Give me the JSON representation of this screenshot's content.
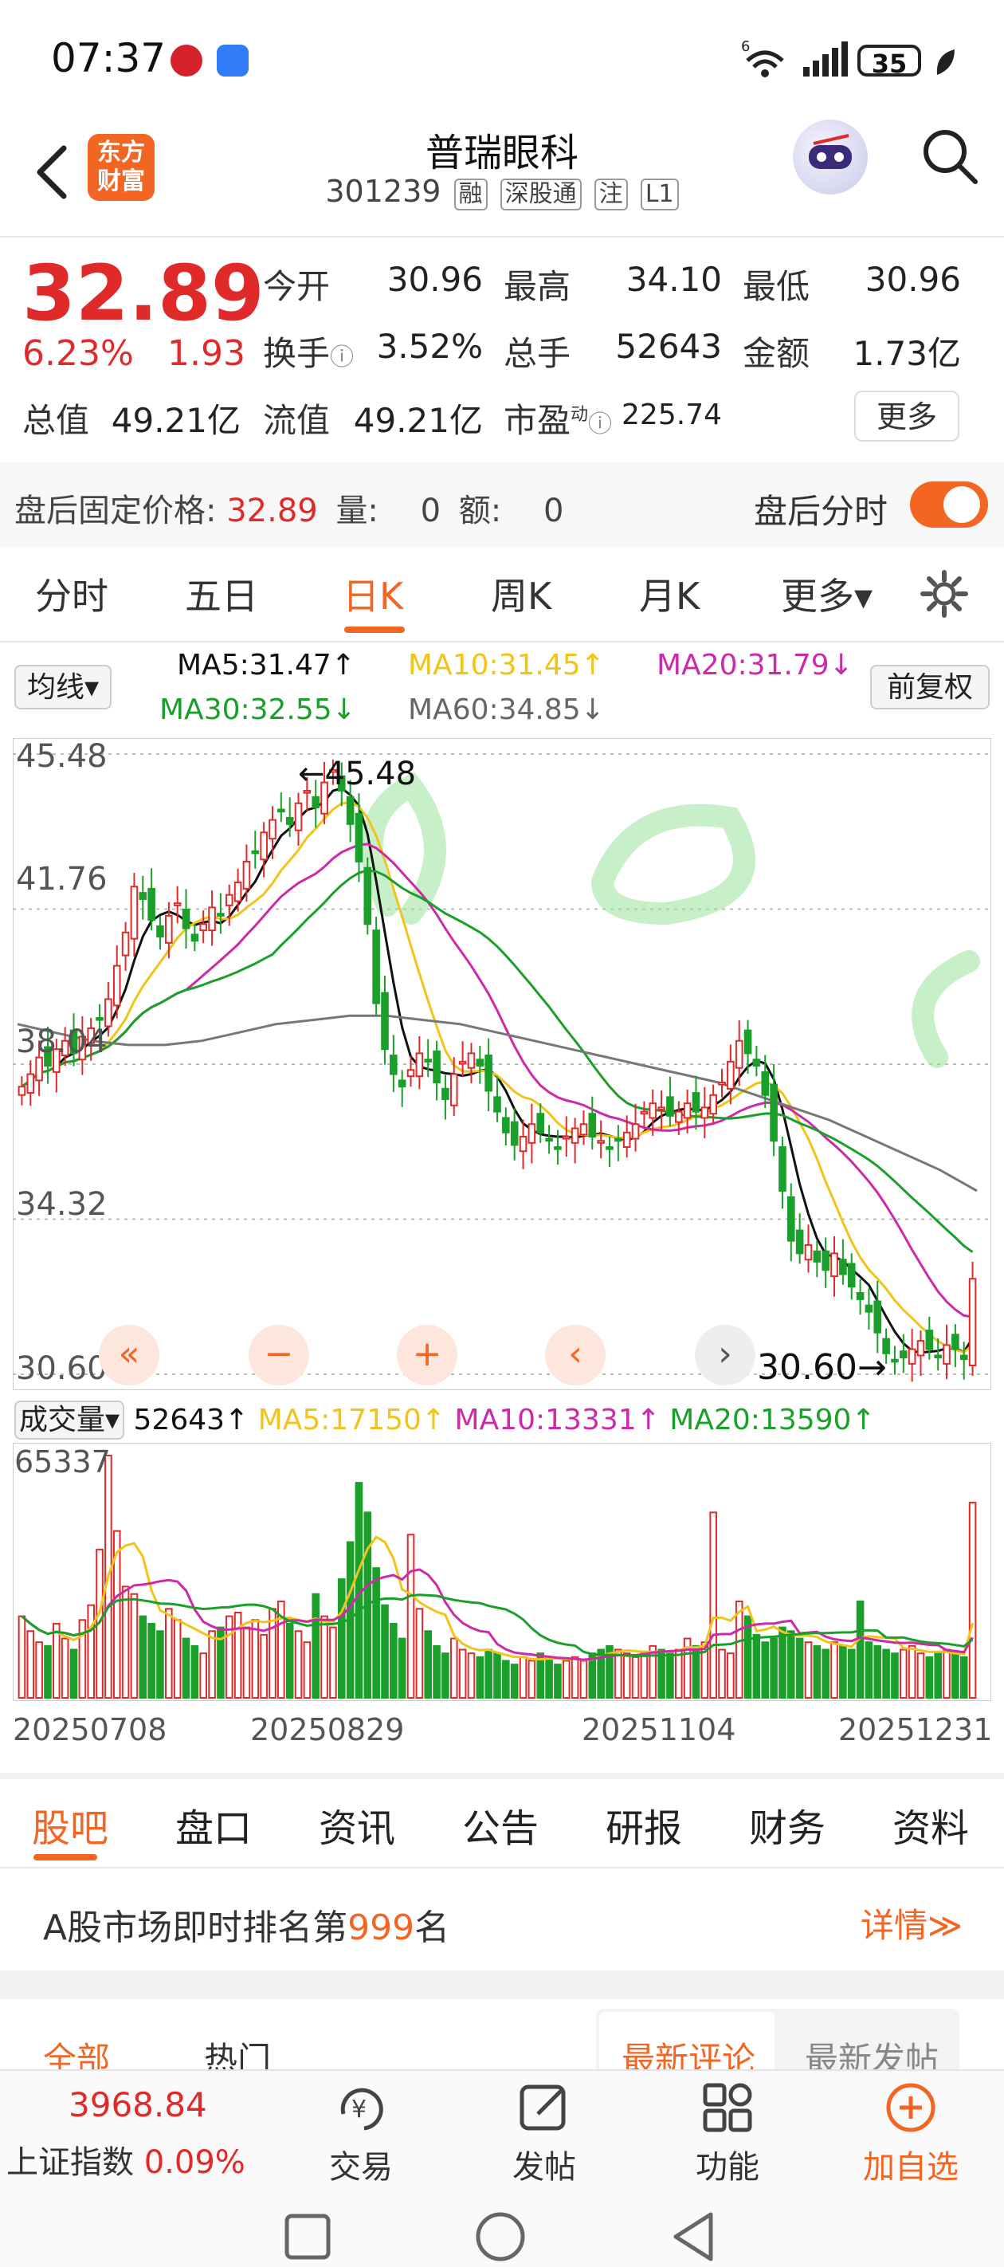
{
  "status_bar": {
    "time": "07:37",
    "battery": "35",
    "network": "6"
  },
  "header": {
    "logo_text_1": "东方",
    "logo_text_2": "财富",
    "stock_name": "普瑞眼科",
    "stock_code": "301239",
    "tags": [
      "融",
      "深股通",
      "注",
      "L1"
    ]
  },
  "quote": {
    "price": "32.89",
    "change_pct": "6.23%",
    "change_abs": "1.93",
    "open_label": "今开",
    "open_value": "30.96",
    "high_label": "最高",
    "high_value": "34.10",
    "low_label": "最低",
    "low_value": "30.96",
    "turnover_label": "换手",
    "turnover_value": "3.52%",
    "volume_label": "总手",
    "volume_value": "52643",
    "amount_label": "金额",
    "amount_value": "1.73亿",
    "mktcap_label": "总值",
    "mktcap_value": "49.21亿",
    "float_label": "流值",
    "float_value": "49.21亿",
    "pe_label": "市盈",
    "pe_superscript": "动",
    "pe_value": "225.74",
    "more_label": "更多"
  },
  "after_hours": {
    "label": "盘后固定价格:",
    "price": "32.89",
    "vol_label": "量:",
    "vol_value": "0",
    "amt_label": "额:",
    "amt_value": "0",
    "intraday_label": "盘后分时",
    "toggle_on": true
  },
  "chart_tabs": [
    {
      "label": "分时"
    },
    {
      "label": "五日"
    },
    {
      "label": "日K"
    },
    {
      "label": "周K"
    },
    {
      "label": "月K"
    },
    {
      "label": "更多▾"
    }
  ],
  "active_chart_tab": "日K",
  "ma_bar": {
    "select_label": "均线▾",
    "ma5": "MA5:31.47↑",
    "ma10": "MA10:31.45↑",
    "ma20": "MA20:31.79↓",
    "ma30": "MA30:32.55↓",
    "ma60": "MA60:34.85↓",
    "adjust_label": "前复权"
  },
  "colors": {
    "up": "#e02a2a",
    "down": "#1aa02a",
    "ma5": "#111111",
    "ma10": "#f0c419",
    "ma20": "#cc2aa8",
    "ma30": "#1aa02a",
    "ma60": "#777777",
    "accent": "#f26522"
  },
  "kline": {
    "high_marker": "←45.48",
    "low_marker": "30.60→",
    "nav_icons": [
      "double-left-icon",
      "zoom-out-icon",
      "zoom-in-icon",
      "left-icon",
      "right-icon"
    ]
  },
  "volume_bar": {
    "select_label": "成交量▾",
    "vol": "52643↑",
    "ma5": "MA5:17150↑",
    "ma10": "MA10:13331↑",
    "ma20": "MA20:13590↑",
    "max_label": "65337"
  },
  "chart_data": {
    "type": "candlestick",
    "y_ticks": [
      "45.48",
      "41.76",
      "38.04",
      "34.32",
      "30.60"
    ],
    "ylim": [
      30.6,
      45.48
    ],
    "x_ticks": [
      "20250708",
      "20250829",
      "20251104",
      "20251231"
    ],
    "close_series": [
      37.5,
      37.8,
      38.2,
      38.0,
      38.4,
      38.6,
      38.3,
      38.7,
      38.9,
      39.1,
      39.6,
      40.4,
      41.2,
      42.3,
      42.0,
      41.5,
      41.1,
      41.6,
      41.9,
      41.3,
      41.0,
      41.4,
      41.8,
      41.6,
      42.1,
      42.4,
      42.9,
      43.1,
      43.6,
      43.9,
      44.1,
      43.8,
      44.3,
      44.6,
      44.2,
      44.8,
      45.1,
      44.6,
      43.8,
      42.9,
      41.4,
      39.5,
      38.4,
      37.8,
      37.5,
      37.9,
      38.3,
      38.1,
      37.6,
      37.2,
      37.8,
      38.1,
      38.3,
      38.0,
      37.4,
      36.9,
      36.4,
      36.1,
      36.3,
      36.6,
      36.4,
      36.2,
      36.0,
      36.3,
      36.5,
      36.6,
      36.3,
      36.2,
      36.0,
      36.2,
      36.4,
      36.6,
      36.9,
      37.1,
      37.0,
      36.8,
      36.9,
      37.1,
      36.9,
      37.0,
      37.3,
      37.6,
      38.1,
      38.6,
      38.3,
      38.0,
      37.3,
      36.2,
      35.0,
      33.8,
      33.5,
      33.7,
      33.3,
      33.1,
      33.5,
      33.0,
      32.7,
      32.4,
      32.1,
      31.6,
      31.1,
      30.9,
      31.0,
      31.2,
      31.4,
      31.2,
      31.0,
      31.3,
      31.2,
      30.96,
      32.89
    ],
    "volume_series": [
      22000,
      18000,
      15000,
      14000,
      20000,
      16000,
      13000,
      21000,
      25000,
      40000,
      65337,
      45000,
      30000,
      28000,
      22000,
      20000,
      18000,
      24000,
      21000,
      16000,
      14000,
      12000,
      18000,
      19000,
      22000,
      23000,
      19000,
      21000,
      17000,
      24000,
      26000,
      20000,
      18000,
      15000,
      28000,
      22000,
      19000,
      32000,
      42000,
      58000,
      50000,
      35000,
      25000,
      20000,
      16000,
      44000,
      24000,
      18000,
      14000,
      12000,
      16000,
      13000,
      12000,
      11000,
      13000,
      12000,
      10000,
      9000,
      11000,
      10000,
      12000,
      11000,
      9000,
      10000,
      11000,
      10000,
      12000,
      13000,
      14000,
      13000,
      12000,
      11000,
      12000,
      14000,
      13000,
      12000,
      13000,
      16000,
      14000,
      15000,
      50000,
      13000,
      12000,
      26000,
      22000,
      17000,
      15000,
      16000,
      19000,
      18000,
      16000,
      15000,
      14000,
      13000,
      15000,
      14000,
      13000,
      26000,
      15000,
      14000,
      13000,
      12000,
      13000,
      14000,
      12000,
      11000,
      12000,
      13000,
      12000,
      11000,
      52643
    ],
    "ma60_series": [
      39.0,
      38.8,
      38.6,
      38.5,
      38.5,
      38.6,
      38.8,
      39.0,
      39.1,
      39.2,
      39.2,
      39.1,
      39.0,
      38.8,
      38.6,
      38.4,
      38.2,
      38.0,
      37.8,
      37.6,
      37.3,
      37.0,
      36.7,
      36.3,
      35.9,
      35.5,
      35.0
    ]
  },
  "bottom_tabs": [
    {
      "label": "股吧"
    },
    {
      "label": "盘口"
    },
    {
      "label": "资讯"
    },
    {
      "label": "公告"
    },
    {
      "label": "研报"
    },
    {
      "label": "财务"
    },
    {
      "label": "资料"
    }
  ],
  "rank": {
    "prefix": "A股市场即时排名第",
    "number": "999",
    "suffix": "名",
    "detail": "详情≫"
  },
  "feed_tabs": {
    "all": "全部",
    "hot": "热门",
    "latest_comment": "最新评论",
    "latest_post": "最新发帖"
  },
  "bottom_nav": {
    "index_value": "3968.84",
    "index_name": "上证指数",
    "index_change": "0.09%",
    "items": [
      {
        "label": "交易",
        "icon": "yuan-cycle-icon"
      },
      {
        "label": "发帖",
        "icon": "edit-icon"
      },
      {
        "label": "功能",
        "icon": "grid-icon"
      },
      {
        "label": "加自选",
        "icon": "plus-circle-icon"
      }
    ]
  }
}
